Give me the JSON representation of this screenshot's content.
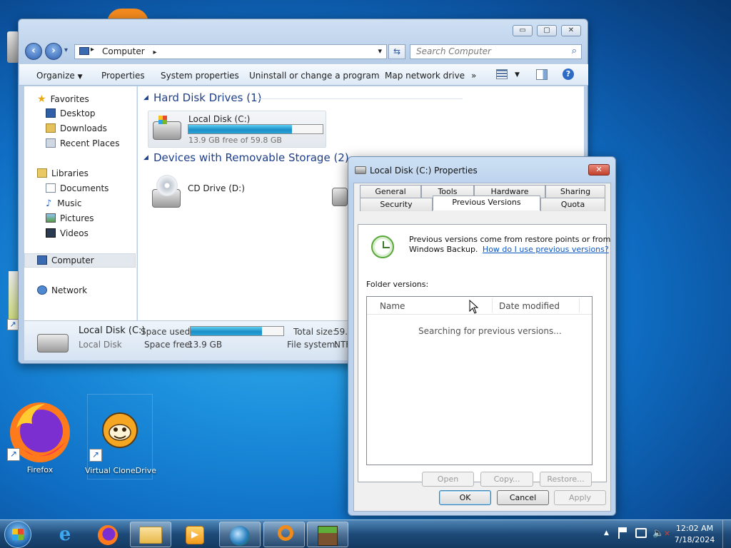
{
  "desktop": {
    "icons": [
      {
        "label": "Firefox"
      },
      {
        "label": "Virtual CloneDrive"
      }
    ]
  },
  "explorer": {
    "window_controls": {
      "minimize": "▭",
      "maximize": "▢",
      "close": "✕"
    },
    "address": {
      "root_glyph": "▸",
      "location": "Computer",
      "chevron": "▸",
      "dropdown": "▾"
    },
    "search": {
      "placeholder": "Search Computer"
    },
    "commands": {
      "organize": "Organize",
      "properties": "Properties",
      "system_properties": "System properties",
      "uninstall": "Uninstall or change a program",
      "map_drive": "Map network drive",
      "more": "»"
    },
    "nav": {
      "favorites": "Favorites",
      "desktop": "Desktop",
      "downloads": "Downloads",
      "recent": "Recent Places",
      "libraries": "Libraries",
      "documents": "Documents",
      "music": "Music",
      "pictures": "Pictures",
      "videos": "Videos",
      "computer": "Computer",
      "network": "Network"
    },
    "groups": {
      "hdd": "Hard Disk Drives (1)",
      "removable": "Devices with Removable Storage (2)"
    },
    "drives": {
      "c_name": "Local Disk (C:)",
      "c_free": "13.9 GB free of 59.8 GB",
      "c_used_fraction": 0.77,
      "d_name": "CD Drive (D:)"
    },
    "details": {
      "name": "Local Disk (C:)",
      "type": "Local Disk",
      "space_used_label": "Space used:",
      "space_used_fraction": 0.77,
      "space_free_label": "Space free:",
      "space_free": "13.9 GB",
      "total_size_label": "Total size:",
      "total_size": "59.8",
      "filesystem_label": "File system:",
      "filesystem": "NTF"
    }
  },
  "props": {
    "title": "Local Disk (C:) Properties",
    "close": "✕",
    "tabs_back": [
      "General",
      "Tools",
      "Hardware",
      "Sharing"
    ],
    "tabs_front": [
      "Security",
      "Previous Versions",
      "Quota"
    ],
    "intro_line1": "Previous versions come from restore points or from",
    "intro_line2": "Windows Backup.",
    "help_link": "How do I use previous versions?",
    "folder_versions": "Folder versions:",
    "col_name": "Name",
    "col_date": "Date modified",
    "searching": "Searching for previous versions...",
    "btn_open": "Open",
    "btn_copy": "Copy...",
    "btn_restore": "Restore...",
    "btn_ok": "OK",
    "btn_cancel": "Cancel",
    "btn_apply": "Apply"
  },
  "taskbar": {
    "time": "12:02 AM",
    "date": "7/18/2024",
    "tray_arrow": "▲"
  }
}
